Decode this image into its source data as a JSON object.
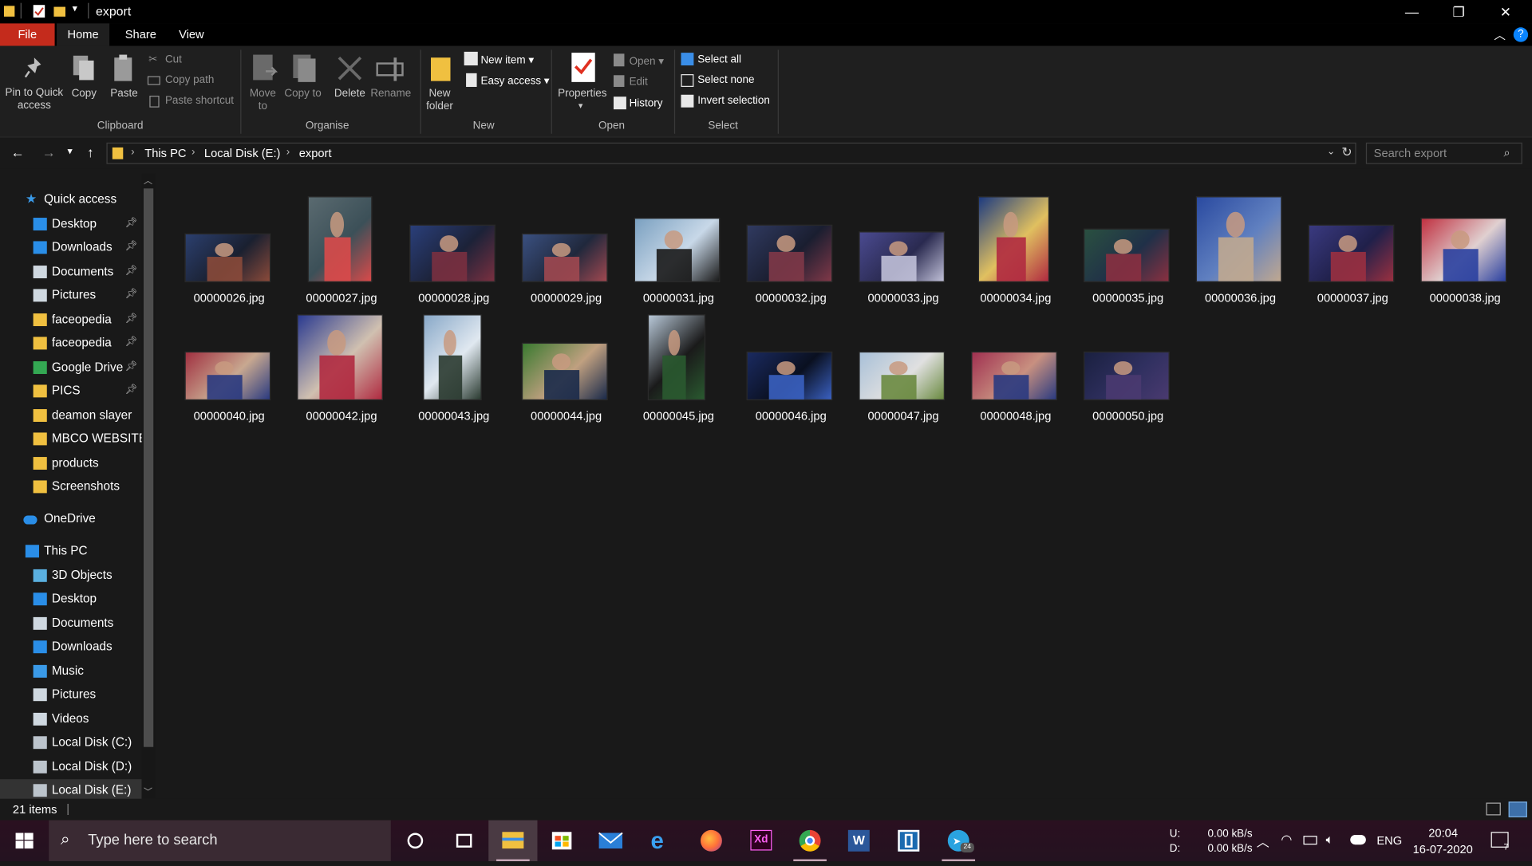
{
  "window": {
    "title": "export",
    "minimize": "—",
    "restore": "❐",
    "close": "✕"
  },
  "tabs": [
    "File",
    "Home",
    "Share",
    "View"
  ],
  "ribbon": {
    "clipboard": {
      "pin": "Pin to Quick access",
      "copy": "Copy",
      "paste": "Paste",
      "cut": "Cut",
      "copy_path": "Copy path",
      "paste_shortcut": "Paste shortcut",
      "label": "Clipboard"
    },
    "organise": {
      "move_to": "Move to",
      "copy_to": "Copy to",
      "delete": "Delete",
      "rename": "Rename",
      "label": "Organise"
    },
    "new": {
      "new_folder": "New folder",
      "new_item": "New item",
      "easy_access": "Easy access",
      "label": "New"
    },
    "open": {
      "properties": "Properties",
      "open": "Open",
      "edit": "Edit",
      "history": "History",
      "label": "Open"
    },
    "select": {
      "select_all": "Select all",
      "select_none": "Select none",
      "invert": "Invert selection",
      "label": "Select"
    }
  },
  "address": {
    "crumbs": [
      "This PC",
      "Local Disk (E:)",
      "export"
    ],
    "search_placeholder": "Search export"
  },
  "nav": {
    "quick_access": "Quick access",
    "quick_items": [
      {
        "label": "Desktop",
        "icon": "desktop-icon",
        "pinned": true
      },
      {
        "label": "Downloads",
        "icon": "downloads-icon",
        "pinned": true
      },
      {
        "label": "Documents",
        "icon": "documents-icon",
        "pinned": true
      },
      {
        "label": "Pictures",
        "icon": "pictures-icon",
        "pinned": true
      },
      {
        "label": "faceopedia",
        "icon": "folder-icon",
        "pinned": true
      },
      {
        "label": "faceopedia",
        "icon": "folder-icon",
        "pinned": true
      },
      {
        "label": "Google Drive",
        "icon": "google-drive-icon",
        "pinned": true
      },
      {
        "label": "PICS",
        "icon": "folder-icon",
        "pinned": true
      },
      {
        "label": "deamon slayer",
        "icon": "folder-icon",
        "pinned": false
      },
      {
        "label": "MBCO WEBSITE",
        "icon": "folder-icon",
        "pinned": false
      },
      {
        "label": "products",
        "icon": "folder-icon",
        "pinned": false
      },
      {
        "label": "Screenshots",
        "icon": "folder-icon",
        "pinned": false
      }
    ],
    "onedrive": "OneDrive",
    "this_pc": "This PC",
    "pc_items": [
      {
        "label": "3D Objects",
        "icon": "3d-objects-icon"
      },
      {
        "label": "Desktop",
        "icon": "desktop-icon"
      },
      {
        "label": "Documents",
        "icon": "documents-icon"
      },
      {
        "label": "Downloads",
        "icon": "downloads-icon"
      },
      {
        "label": "Music",
        "icon": "music-icon"
      },
      {
        "label": "Pictures",
        "icon": "pictures-icon"
      },
      {
        "label": "Videos",
        "icon": "videos-icon"
      },
      {
        "label": "Local Disk (C:)",
        "icon": "drive-icon"
      },
      {
        "label": "Local Disk (D:)",
        "icon": "drive-icon"
      },
      {
        "label": "Local Disk (E:)",
        "icon": "drive-icon",
        "selected": true
      }
    ]
  },
  "files": [
    {
      "name": "00000026.jpg",
      "palette": [
        "#2b3f6e",
        "#8a4a3a",
        "#1a2030"
      ]
    },
    {
      "name": "00000027.jpg",
      "palette": [
        "#5a6a70",
        "#d94a4a",
        "#3c5058"
      ]
    },
    {
      "name": "00000028.jpg",
      "palette": [
        "#2a3f7a",
        "#7a3040",
        "#1c2238"
      ]
    },
    {
      "name": "00000029.jpg",
      "palette": [
        "#3a5080",
        "#a04850",
        "#20283c"
      ]
    },
    {
      "name": "00000031.jpg",
      "palette": [
        "#7aa0c0",
        "#1a1a1a",
        "#c8d8e8"
      ]
    },
    {
      "name": "00000032.jpg",
      "palette": [
        "#303a60",
        "#803848",
        "#1a1e30"
      ]
    },
    {
      "name": "00000033.jpg",
      "palette": [
        "#4a4a90",
        "#c0c0d8",
        "#2a2a50"
      ]
    },
    {
      "name": "00000034.jpg",
      "palette": [
        "#1c3a80",
        "#b02a40",
        "#e0c060"
      ]
    },
    {
      "name": "00000035.jpg",
      "palette": [
        "#2a5040",
        "#8a3040",
        "#203048"
      ]
    },
    {
      "name": "00000036.jpg",
      "palette": [
        "#2a4aa0",
        "#c0a890",
        "#6080c0"
      ]
    },
    {
      "name": "00000037.jpg",
      "palette": [
        "#3a3a80",
        "#9a3040",
        "#20204a"
      ]
    },
    {
      "name": "00000038.jpg",
      "palette": [
        "#c03040",
        "#2a40a0",
        "#e0d0d0"
      ]
    },
    {
      "name": "00000040.jpg",
      "palette": [
        "#a03040",
        "#2a3a80",
        "#c8a890"
      ]
    },
    {
      "name": "00000042.jpg",
      "palette": [
        "#2a3a90",
        "#b02a40",
        "#d0c0b0"
      ]
    },
    {
      "name": "00000043.jpg",
      "palette": [
        "#88a8c8",
        "#2a3a30",
        "#e0e8f0"
      ]
    },
    {
      "name": "00000044.jpg",
      "palette": [
        "#3a7a30",
        "#1a2a4a",
        "#c0a080"
      ]
    },
    {
      "name": "00000045.jpg",
      "palette": [
        "#b8c8d8",
        "#2a5a30",
        "#1a1a1a"
      ]
    },
    {
      "name": "00000046.jpg",
      "palette": [
        "#1a2a60",
        "#3a60c0",
        "#0a1020"
      ]
    },
    {
      "name": "00000047.jpg",
      "palette": [
        "#a8c0d8",
        "#6a8a40",
        "#e0e0e0"
      ]
    },
    {
      "name": "00000048.jpg",
      "palette": [
        "#a03050",
        "#2a3a80",
        "#c89080"
      ]
    },
    {
      "name": "00000050.jpg",
      "palette": [
        "#1a2040",
        "#4a3a70",
        "#303060"
      ]
    }
  ],
  "status": {
    "count": "21 items"
  },
  "taskbar": {
    "search_placeholder": "Type here to search",
    "net_up_label": "U:",
    "net_down_label": "D:",
    "net_up": "0.00 kB/s",
    "net_down": "0.00 kB/s",
    "lang": "ENG",
    "time": "20:04",
    "date": "16-07-2020",
    "telegram_badge": "24",
    "notifications_badge": "7"
  },
  "colors": {
    "file_tab": "#c42b1c",
    "folder": "#f0c040",
    "accent": "#0a84ff"
  }
}
